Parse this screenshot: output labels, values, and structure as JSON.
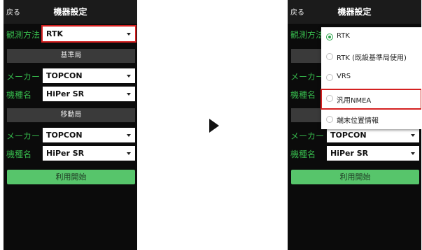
{
  "left_screen": {
    "back_label": "戻る",
    "title": "機器設定",
    "survey_method_label": "観測方法",
    "survey_method_value": "RTK",
    "base_section": "基準局",
    "base_maker_label": "メーカー",
    "base_maker_value": "TOPCON",
    "base_model_label": "機種名",
    "base_model_value": "HiPer SR",
    "rover_section": "移動局",
    "rover_maker_label": "メーカー",
    "rover_maker_value": "TOPCON",
    "rover_model_label": "機種名",
    "rover_model_value": "HiPer SR",
    "start_label": "利用開始"
  },
  "right_screen": {
    "back_label": "戻る",
    "title": "機器設定",
    "survey_method_label": "観測方法",
    "maker_label": "メーカー",
    "model_label": "機種名",
    "rover_maker_label": "メーカー",
    "rover_maker_value": "TOPCON",
    "rover_model_label": "機種名",
    "rover_model_value": "HiPer SR",
    "start_label": "利用開始",
    "dropdown_options": [
      {
        "label": "RTK",
        "selected": true
      },
      {
        "label": "RTK (既設基準局使用)",
        "selected": false
      },
      {
        "label": "VRS",
        "selected": false
      },
      {
        "label": "汎用NMEA",
        "selected": false,
        "highlighted": true
      },
      {
        "label": "端末位置情報",
        "selected": false
      }
    ]
  },
  "colors": {
    "accent_green": "#35b34a",
    "button_green": "#57c56b",
    "highlight_red": "#d42020"
  }
}
